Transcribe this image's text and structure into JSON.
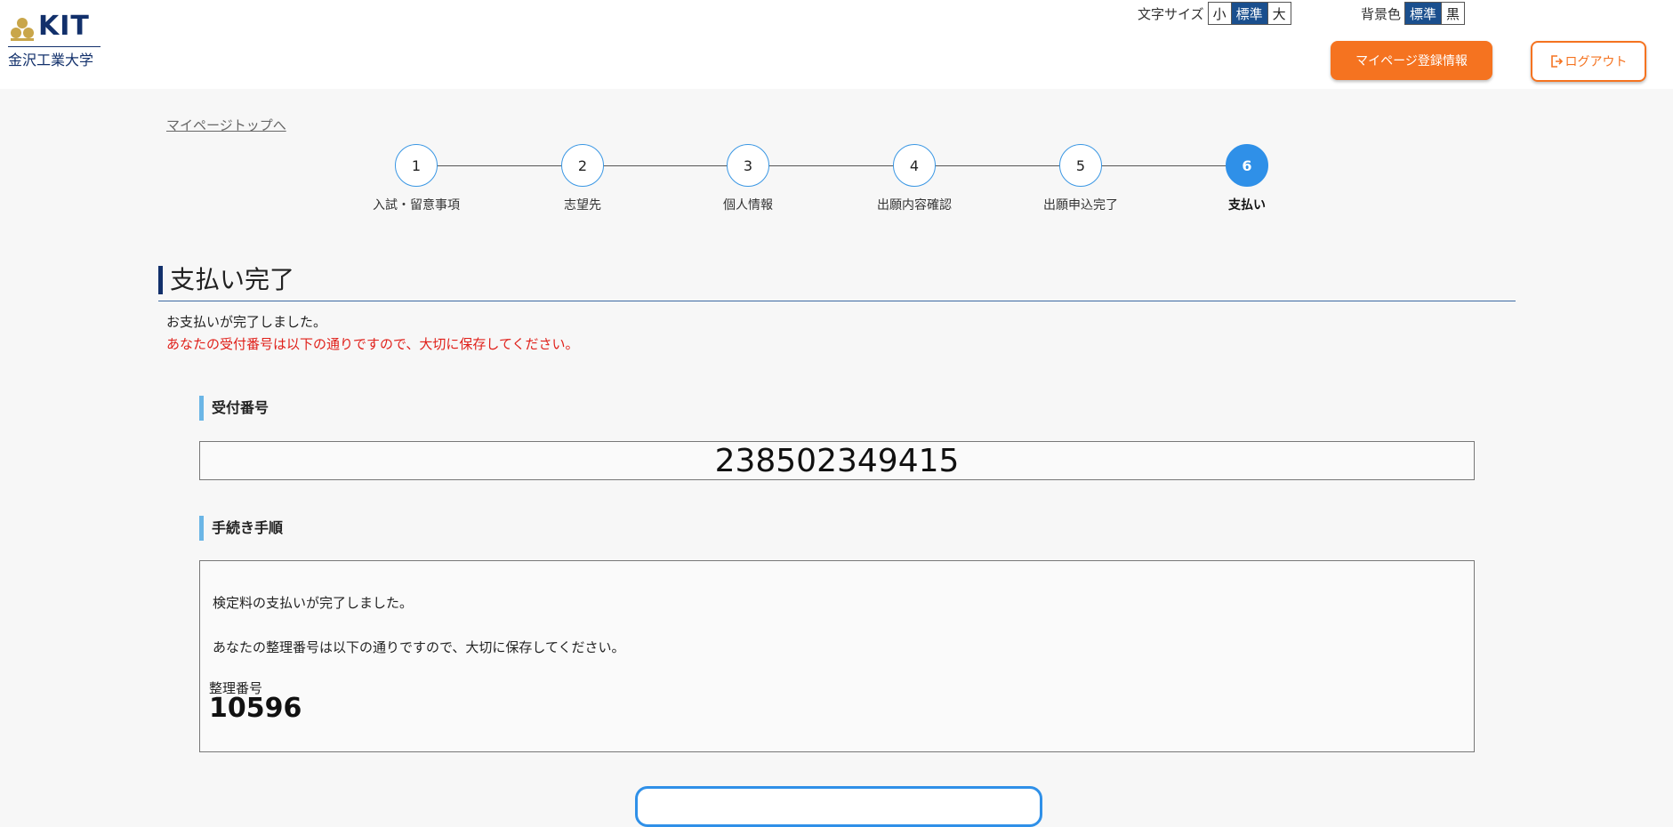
{
  "header": {
    "logo": {
      "text": "KIT",
      "subtitle": "金沢工業大学"
    },
    "font_size": {
      "label": "文字サイズ",
      "options": [
        "小",
        "標準",
        "大"
      ],
      "selected": "標準"
    },
    "bg_color": {
      "label": "背景色",
      "options": [
        "標準",
        "黒"
      ],
      "selected": "標準"
    },
    "mypage_button": "マイページ登録情報",
    "logout_button": "ログアウト"
  },
  "breadcrumb": {
    "top_link": "マイページトップへ"
  },
  "steps": [
    {
      "number": "1",
      "label": "入試・留意事項"
    },
    {
      "number": "2",
      "label": "志望先"
    },
    {
      "number": "3",
      "label": "個人情報"
    },
    {
      "number": "4",
      "label": "出願内容確認"
    },
    {
      "number": "5",
      "label": "出願申込完了"
    },
    {
      "number": "6",
      "label": "支払い"
    }
  ],
  "current_step": "6",
  "main": {
    "title": "支払い完了",
    "message": "お支払いが完了しました。",
    "notice": "あなたの受付番号は以下の通りですので、大切に保存してください。",
    "receipt": {
      "heading": "受付番号",
      "number": "238502349415"
    },
    "procedure": {
      "heading": "手続き手順",
      "line1": "検定料の支払いが完了しました。",
      "line2": "あなたの整理番号は以下の通りですので、大切に保存してください。",
      "ref_label": "整理番号",
      "ref_number": "10596"
    }
  },
  "colors": {
    "accent_orange": "#f57320",
    "navy": "#12306b",
    "step_blue": "#2f90e8",
    "notice_red": "#e0201a"
  }
}
